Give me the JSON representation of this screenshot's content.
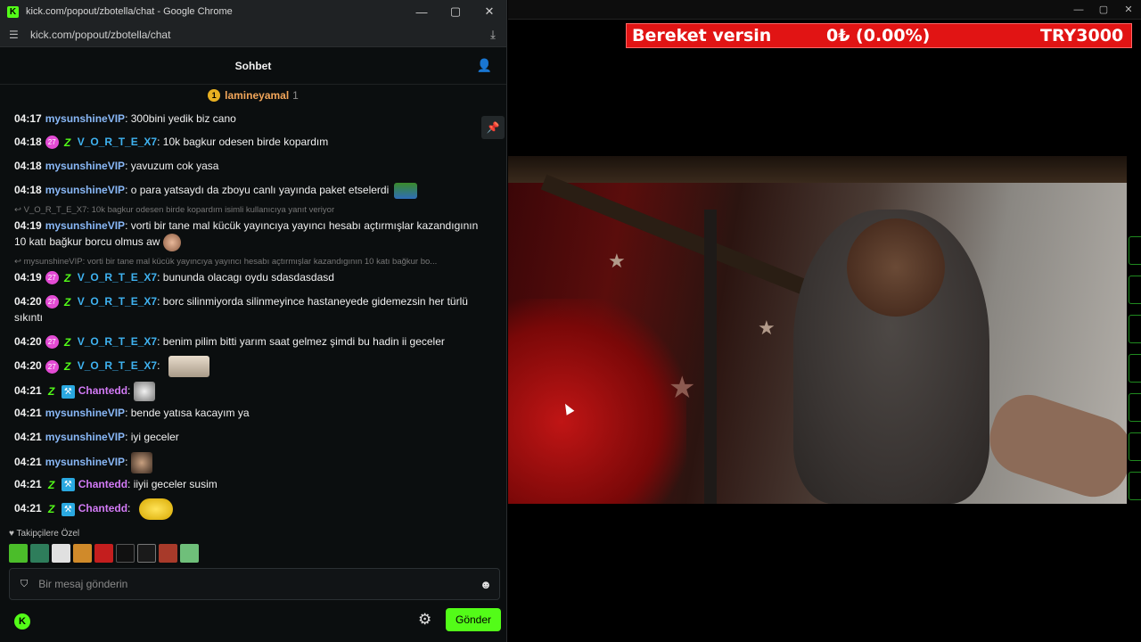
{
  "browser": {
    "window_title": "kick.com/popout/zbotella/chat - Google Chrome",
    "url": "kick.com/popout/zbotella/chat",
    "favicon": "K"
  },
  "chat": {
    "title": "Sohbet",
    "pinned": {
      "badge": "1",
      "name": "lamineyamal",
      "count": "1"
    },
    "messages": [
      {
        "time": "04:17",
        "user": "mysunshineVIP",
        "text": "300bini yedik biz cano"
      },
      {
        "time": "04:18",
        "sub": "27",
        "user": "V_O_R_T_E_X7",
        "text": "10k bagkur odesen birde kopardım"
      },
      {
        "time": "04:18",
        "user": "mysunshineVIP",
        "text": "yavuzum cok yasa"
      },
      {
        "time": "04:18",
        "user": "mysunshineVIP",
        "text": "o para yatsaydı da zboyu canlı yayında paket etselerdi"
      },
      {
        "reply": "V_O_R_T_E_X7: 10k bagkur odesen birde kopardım isimli kullanıcıya yanıt veriyor"
      },
      {
        "time": "04:19",
        "user": "mysunshineVIP",
        "text": "vorti bir tane mal kücük yayıncıya yayıncı hesabı açtırmışlar kazandıgının",
        "text2": "10 katı bağkur borcu olmus aw"
      },
      {
        "reply": "mysunshineVIP: vorti bir tane mal kücük yayıncıya yayıncı hesabı açtırmışlar kazandıgının 10 katı bağkur bo..."
      },
      {
        "time": "04:19",
        "sub": "27",
        "user": "V_O_R_T_E_X7",
        "text": "bununda olacagı oydu sdasdasdasd"
      },
      {
        "time": "04:20",
        "sub": "27",
        "user": "V_O_R_T_E_X7",
        "text": "borc silinmiyorda silinmeyince hastaneyede gidemezsin her türlü",
        "text2": "sıkıntı"
      },
      {
        "time": "04:20",
        "sub": "27",
        "user": "V_O_R_T_E_X7",
        "text": "benim pilim bitti yarım saat gelmez şimdi bu hadin ii geceler"
      },
      {
        "time": "04:20",
        "sub": "27",
        "user": "V_O_R_T_E_X7",
        "text": ""
      },
      {
        "time": "04:21",
        "user": "Chantedd",
        "text": ""
      },
      {
        "time": "04:21",
        "user": "mysunshineVIP",
        "text": "bende yatısa kacayım ya"
      },
      {
        "time": "04:21",
        "user": "mysunshineVIP",
        "text": "iyi geceler"
      },
      {
        "time": "04:21",
        "user": "mysunshineVIP",
        "text": ""
      },
      {
        "time": "04:21",
        "user": "Chantedd",
        "text": "iiyii geceler susim"
      },
      {
        "time": "04:21",
        "user": "Chantedd",
        "text": ""
      }
    ],
    "followers_label": "Takipçilere Özel",
    "input_placeholder": "Bir mesaj gönderin",
    "send_label": "Gönder",
    "colors": {
      "accent": "#53fc18",
      "vip": "#89b8f7",
      "vortex": "#3fb2f0",
      "chantedd": "#d27af5"
    }
  },
  "overlay": {
    "ticker_left": "Bereket versin",
    "ticker_mid": "0₺ (0.00%)",
    "ticker_right": "TRY3000",
    "ticker_color": "#e11414"
  }
}
